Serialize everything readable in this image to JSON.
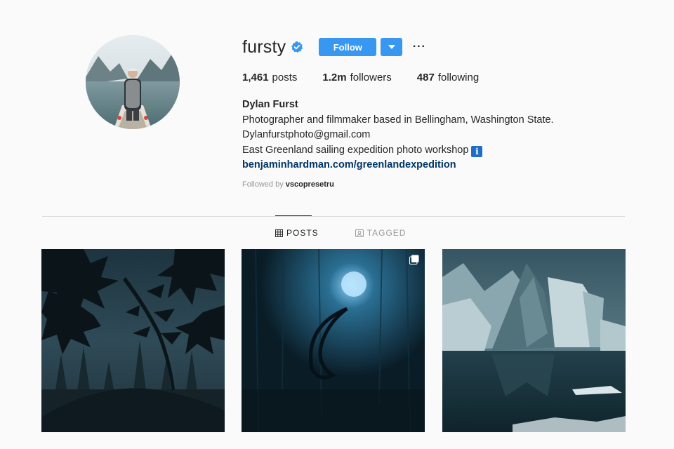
{
  "profile": {
    "username": "fursty",
    "verified": true,
    "follow_label": "Follow",
    "more_label": "···",
    "stats": {
      "posts_count": "1,461",
      "posts_label": "posts",
      "followers_count": "1.2m",
      "followers_label": "followers",
      "following_count": "487",
      "following_label": "following"
    },
    "bio": {
      "full_name": "Dylan Furst",
      "line1": "Photographer and filmmaker based in Bellingham, Washington State.",
      "line2": "Dylanfurstphoto@gmail.com",
      "line3": "East Greenland sailing expedition photo workshop",
      "line3_emoji": "i",
      "link": "benjaminhardman.com/greenlandexpedition"
    },
    "followed_by_label": "Followed by",
    "followed_by_user": "vscopresetru"
  },
  "tabs": [
    {
      "label": "POSTS",
      "icon": "grid-icon",
      "active": true
    },
    {
      "label": "TAGGED",
      "icon": "tagged-icon",
      "active": false
    }
  ],
  "posts": [
    {
      "subject": "maple leaves and pine trees in misty forest",
      "multi": false
    },
    {
      "subject": "moon drawn on foggy window with glowing light",
      "multi": true
    },
    {
      "subject": "iceberg reflected in dark water",
      "multi": false
    }
  ],
  "colors": {
    "accent": "#3897f0",
    "link": "#003569",
    "background": "#fafafa",
    "muted": "#999999"
  }
}
